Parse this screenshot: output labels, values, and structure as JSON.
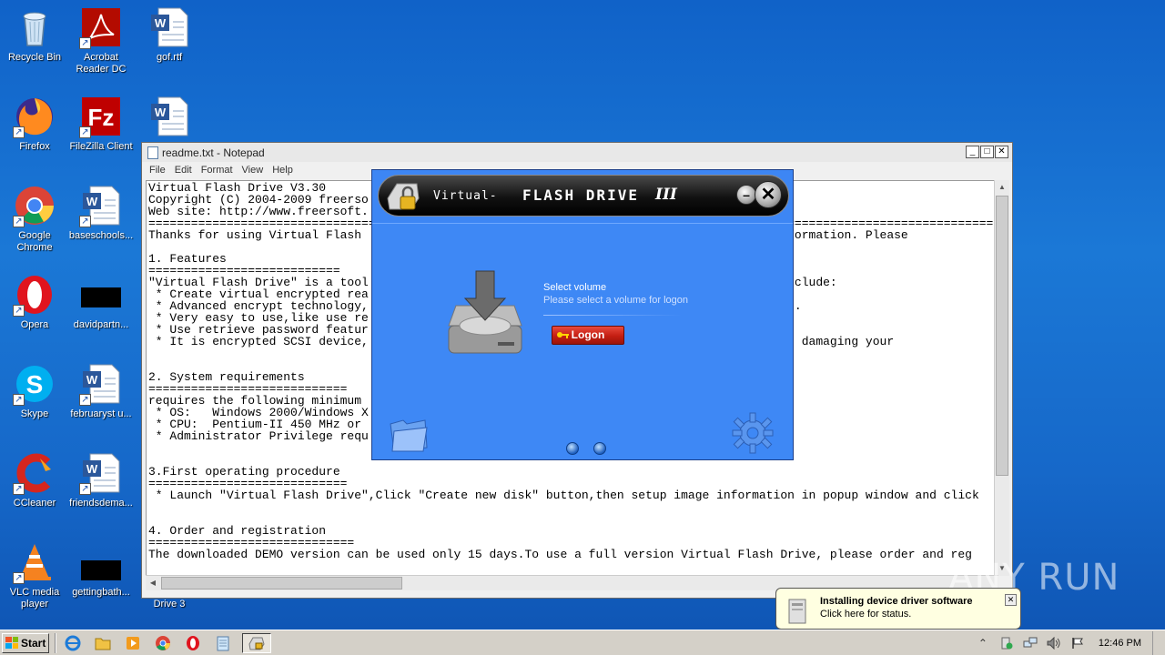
{
  "desktop": {
    "icons": [
      {
        "label": "Recycle Bin"
      },
      {
        "label": "Acrobat Reader DC"
      },
      {
        "label": "gof.rtf"
      },
      {
        "label": "Firefox"
      },
      {
        "label": "FileZilla Client"
      },
      {
        "label": "Google Chrome"
      },
      {
        "label": "baseschools..."
      },
      {
        "label": "Opera"
      },
      {
        "label": "davidpartn..."
      },
      {
        "label": "Skype"
      },
      {
        "label": "februaryst u..."
      },
      {
        "label": "CCleaner"
      },
      {
        "label": "friendsdema..."
      },
      {
        "label": "VLC media player"
      },
      {
        "label": "gettingbath..."
      },
      {
        "label": "Drive 3"
      }
    ]
  },
  "notepad": {
    "title": "readme.txt - Notepad",
    "menu": [
      "File",
      "Edit",
      "Format",
      "View",
      "Help"
    ],
    "lines": [
      "Virtual Flash Drive V3.30",
      "Copyright (C) 2004-2009 freerso",
      "Web site: http://www.freersoft.",
      "==============================================================================================================================",
      "Thanks for using Virtual Flash                                                  chnical information. Please",
      "",
      "1. Features",
      "===========================",
      "\"Virtual Flash Drive\" is a tool                                                 features include:",
      " * Create virtual encrypted rea",
      " * Advanced encrypt technology,                                                 elete ect...",
      " * Very easy to use,like use re",
      " * Use retrieve password featur",
      " * It is encrypted SCSI device,                                                 worry about damaging your",
      "",
      "",
      "2. System requirements",
      "============================",
      "requires the following minimum",
      " * OS:   Windows 2000/Windows X",
      " * CPU:  Pentium-II 450 MHz or",
      " * Administrator Privilege requ",
      "",
      "",
      "3.First operating procedure",
      "============================",
      " * Launch \"Virtual Flash Drive\",Click \"Create new disk\" button,then setup image information in popup window and click",
      "",
      "",
      "4. Order and registration",
      "=============================",
      "The downloaded DEMO version can be used only 15 days.To use a full version Virtual Flash Drive, please order and reg"
    ]
  },
  "vfd": {
    "title_left": "Virtual-",
    "title_main": "FLASH DRIVE",
    "title_version": "III",
    "select_title": "Select volume",
    "select_sub": "Please select a volume for logon",
    "logon_label": "Logon"
  },
  "balloon": {
    "title": "Installing device driver software",
    "subtitle": "Click here for status."
  },
  "watermark": "ANY RUN",
  "taskbar": {
    "start_label": "Start",
    "clock": "12:46 PM"
  },
  "colors": {
    "desktop_bg": "#1668c9",
    "dialog_bg": "#3e88f5",
    "logon_button": "#c41e12",
    "balloon_bg": "#ffffe1"
  }
}
